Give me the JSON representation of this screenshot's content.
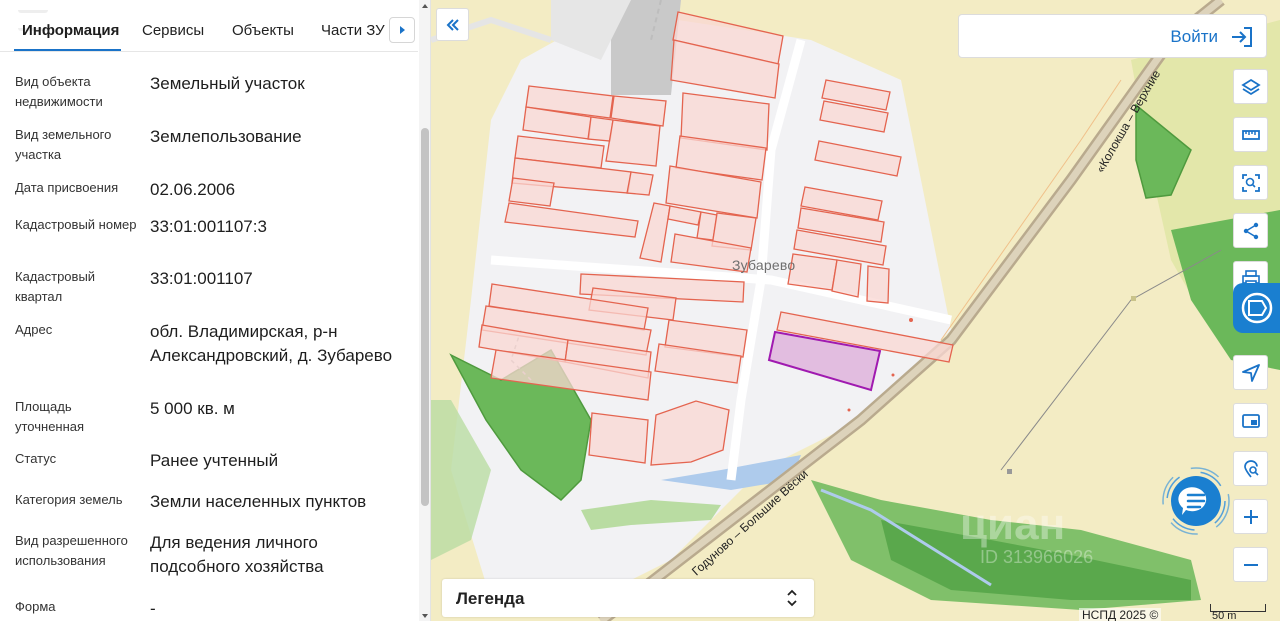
{
  "tabs": [
    {
      "label": "Информация",
      "active": true
    },
    {
      "label": "Сервисы",
      "active": false
    },
    {
      "label": "Объекты",
      "active": false
    },
    {
      "label": "Части ЗУ",
      "active": false
    }
  ],
  "rows": [
    {
      "label": "Вид объекта недвижимости",
      "value": "Земельный участок"
    },
    {
      "label": "Вид земельного участка",
      "value": "Землепользование"
    },
    {
      "label": "Дата присвоения",
      "value": "02.06.2006"
    },
    {
      "label": "Кадастровый номер",
      "value": "33:01:001107:3"
    },
    {
      "label": "Кадастровый квартал",
      "value": "33:01:001107"
    },
    {
      "label": "Адрес",
      "value": "обл. Владимирская, р-н Александровский, д. Зубарево"
    },
    {
      "label": "Площадь уточненная",
      "value": "5 000 кв. м"
    },
    {
      "label": "Статус",
      "value": "Ранее учтенный"
    },
    {
      "label": "Категория земель",
      "value": "Земли населенных пунктов"
    },
    {
      "label": "Вид разрешенного использования",
      "value": "Для ведения личного подсобного хозяйства"
    },
    {
      "label": "Форма",
      "value": "-"
    }
  ],
  "map": {
    "place_label": "Зубарево",
    "road_label_1": "Годуново – Большие Вёски",
    "road_label_2": "«Колокша – Верхние",
    "legend_label": "Легенда",
    "attribution": "НСПД 2025 ©",
    "scale_label": "50 m",
    "watermark": "циан",
    "watermark_id": "ID 313966026"
  },
  "login": {
    "label": "Войти"
  },
  "colors": {
    "accent": "#1a73c8",
    "parcel_fill": "#f9d7d3",
    "parcel_stroke": "#e4644f",
    "selected_stroke": "#a01ab0",
    "forest": "#6bb85a"
  }
}
